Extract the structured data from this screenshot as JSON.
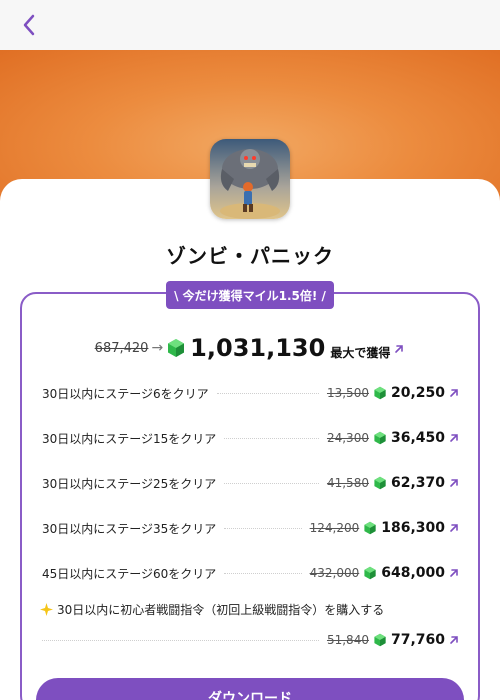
{
  "nav": {
    "back_icon": "chevron-left-icon"
  },
  "app": {
    "title": "ゾンビ・パニック"
  },
  "promo": {
    "tag": "\\ 今だけ獲得マイル1.5倍! /",
    "total_old": "687,420",
    "total_new": "1,031,130",
    "total_suffix": "最大で獲得"
  },
  "tasks": [
    {
      "label": "30日以内にステージ6をクリア",
      "old": "13,500",
      "new": "20,250"
    },
    {
      "label": "30日以内にステージ15をクリア",
      "old": "24,300",
      "new": "36,450"
    },
    {
      "label": "30日以内にステージ25をクリア",
      "old": "41,580",
      "new": "62,370"
    },
    {
      "label": "30日以内にステージ35をクリア",
      "old": "124,200",
      "new": "186,300"
    },
    {
      "label": "45日以内にステージ60をクリア",
      "old": "432,000",
      "new": "648,000"
    }
  ],
  "special_task": {
    "label": "30日以内に初心者戦闘指令（初回上級戦闘指令）を購入する",
    "old": "51,840",
    "new": "77,760"
  },
  "download": {
    "label": "ダウンロード"
  },
  "colors": {
    "accent": "#7e4fc0",
    "banner": "#ec8c3f",
    "gem": "#2fb84a"
  }
}
